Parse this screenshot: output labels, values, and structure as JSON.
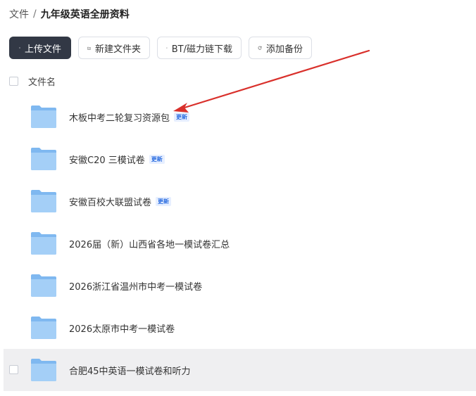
{
  "breadcrumb": {
    "root": "文件",
    "separator": "/",
    "current": "九年级英语全册资料"
  },
  "toolbar": {
    "upload_label": "上传文件",
    "new_folder_label": "新建文件夹",
    "bt_download_label": "BT/磁力链下载",
    "add_backup_label": "添加备份"
  },
  "list": {
    "header_label": "文件名",
    "badge_label": "更新",
    "items": [
      {
        "name": "木板中考二轮复习资源包",
        "badge": "更新"
      },
      {
        "name": "安徽C20 三模试卷",
        "badge": "更新"
      },
      {
        "name": "安徽百校大联盟试卷",
        "badge": "更新"
      },
      {
        "name": "2026届（新）山西省各地一模试卷汇总"
      },
      {
        "name": "2026浙江省温州市中考一模试卷"
      },
      {
        "name": "2026太原市中考一模试卷"
      },
      {
        "name": "合肥45中英语一模试卷和听力"
      }
    ]
  },
  "colors": {
    "primary_button": "#323845",
    "folder": "#7fb8f0",
    "badge_text": "#2b6de0",
    "arrow": "#d9302b",
    "hover_row": "#efeff1"
  },
  "icons": [
    "plus-icon",
    "new-folder-icon",
    "bt-icon",
    "sync-icon",
    "folder-icon"
  ]
}
